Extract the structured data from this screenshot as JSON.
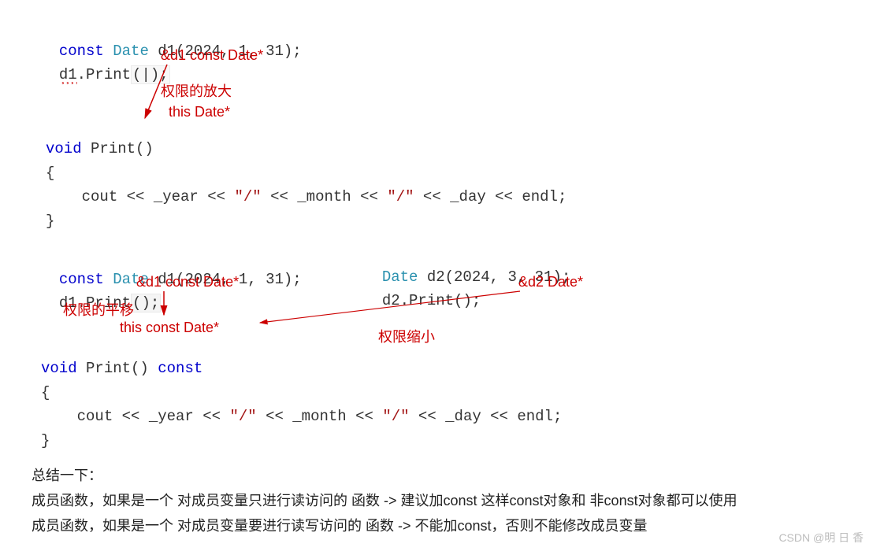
{
  "block1": {
    "line1": {
      "const": "const",
      "Date": "Date",
      "rest": " d1(2024, 1, 31);"
    },
    "line2": {
      "d1": "d1",
      "dot": ".",
      "Print": "Print",
      "paren": "(|);"
    },
    "note_d1": "&d1  const Date*",
    "note_expand": "权限的放大",
    "note_this": "this   Date*",
    "func": {
      "void": "void",
      "Print": "Print",
      "paren": "()",
      "open": "{",
      "body_pre": "    cout << _year << ",
      "str1": "\"/\"",
      "body_mid1": " << _month << ",
      "str2": "\"/\"",
      "body_mid2": " << _day << endl;",
      "close": "}"
    }
  },
  "block2": {
    "left": {
      "const": "const",
      "Date": "Date",
      "rest": " d1(2024, 1, 31);",
      "call_d1": "d1",
      "dot": ".",
      "Print": "Print",
      "paren": "();"
    },
    "right": {
      "Date": "Date",
      "rest": " d2(2024, 3, 31);",
      "call_d2": "d2",
      "dot": ".",
      "Print": "Print",
      "paren": "();"
    },
    "note_d1": "&d1  const Date*",
    "note_d2": "&d2  Date*",
    "note_translate": "权限的平移",
    "note_this_const": "this  const Date*",
    "note_shrink": "权限缩小",
    "func": {
      "void": "void",
      "Print": "Print",
      "paren": "() ",
      "const": "const",
      "open": "{",
      "body_pre": "    cout << _year << ",
      "str1": "\"/\"",
      "body_mid1": " << _month << ",
      "str2": "\"/\"",
      "body_mid2": " << _day << endl;",
      "close": "}"
    }
  },
  "summary": {
    "title": "总结一下：",
    "line1": "成员函数，如果是一个 对成员变量只进行读访问的 函数 -> 建议加const    这样const对象和 非const对象都可以使用",
    "line2": "成员函数，如果是一个 对成员变量要进行读写访问的 函数 -> 不能加const，否则不能修改成员变量"
  },
  "watermark": "CSDN @明 日 香"
}
